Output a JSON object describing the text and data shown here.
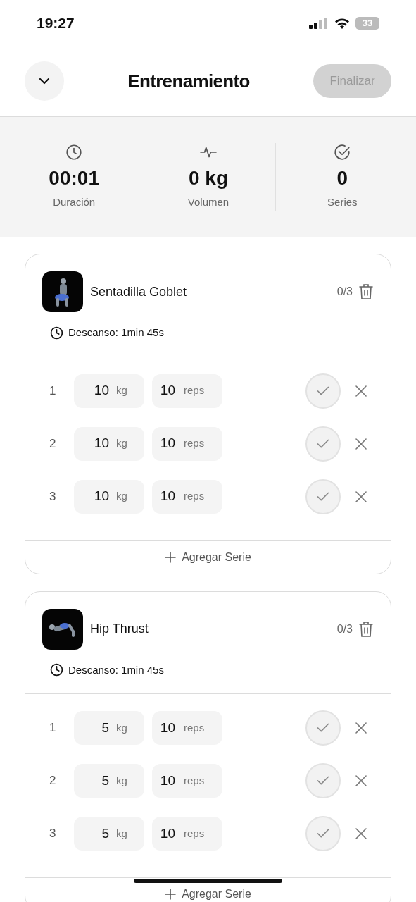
{
  "status_bar": {
    "time": "19:27",
    "battery": "33"
  },
  "header": {
    "title": "Entrenamiento",
    "finish_button": {
      "label": "Finalizar",
      "disabled": true
    }
  },
  "stats": [
    {
      "kind": "clock",
      "value": "00:01",
      "label": "Duración"
    },
    {
      "kind": "pulse",
      "value": "0 kg",
      "label": "Volumen"
    },
    {
      "kind": "check",
      "value": "0",
      "label": "Series"
    }
  ],
  "exercises": [
    {
      "name": "Sentadilla Goblet",
      "progress": "0/3",
      "rest": "Descanso: 1min 45s",
      "sets": [
        {
          "number": "1",
          "weight": "10",
          "weight_unit": "kg",
          "reps": "10",
          "reps_unit": "reps",
          "done": false
        },
        {
          "number": "2",
          "weight": "10",
          "weight_unit": "kg",
          "reps": "10",
          "reps_unit": "reps",
          "done": false
        },
        {
          "number": "3",
          "weight": "10",
          "weight_unit": "kg",
          "reps": "10",
          "reps_unit": "reps",
          "done": false
        }
      ],
      "add_label": "Agregar Serie"
    },
    {
      "name": "Hip Thrust",
      "progress": "0/3",
      "rest": "Descanso: 1min 45s",
      "sets": [
        {
          "number": "1",
          "weight": "5",
          "weight_unit": "kg",
          "reps": "10",
          "reps_unit": "reps",
          "done": false
        },
        {
          "number": "2",
          "weight": "5",
          "weight_unit": "kg",
          "reps": "10",
          "reps_unit": "reps",
          "done": false
        },
        {
          "number": "3",
          "weight": "5",
          "weight_unit": "kg",
          "reps": "10",
          "reps_unit": "reps",
          "done": false
        }
      ],
      "add_label": "Agregar Serie"
    }
  ]
}
